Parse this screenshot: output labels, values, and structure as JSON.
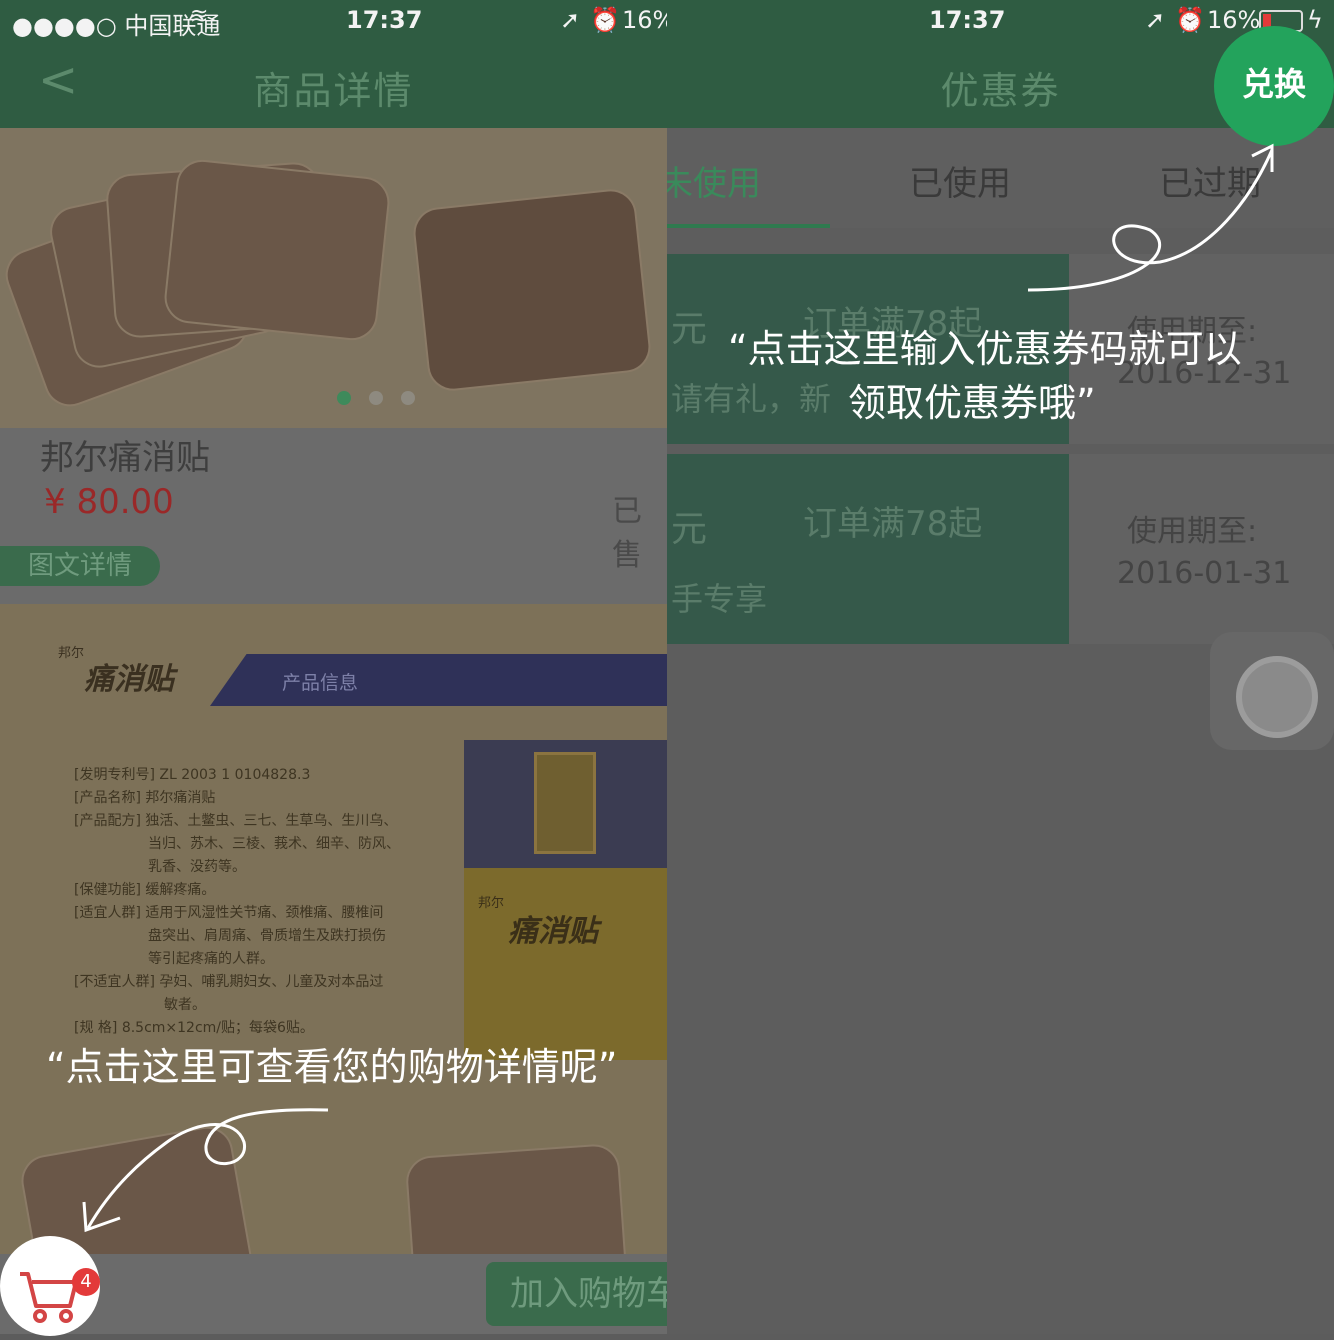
{
  "left": {
    "status": {
      "carrier": "●●●●○ 中国联通",
      "time": "17:37",
      "right": "16%"
    },
    "nav": {
      "back": "<",
      "title": "商品详情"
    },
    "product": {
      "name": "邦尔痛消贴",
      "price": "¥ 80.00",
      "sold": "已售"
    },
    "detail_tab": "图文详情",
    "detail_image": {
      "brand_small": "邦尔",
      "brand": "痛消贴",
      "section": "产品信息",
      "specs": [
        "[发明专利号] ZL 2003 1 0104828.3",
        "[产品名称] 邦尔痛消贴",
        "[产品配方] 独活、土鳖虫、三七、生草乌、生川乌、",
        "当归、苏木、三棱、莪术、细辛、防风、",
        "乳香、没药等。",
        "[保健功能] 缓解疼痛。",
        "[适宜人群] 适用于风湿性关节痛、颈椎痛、腰椎间",
        "盘突出、肩周痛、骨质增生及跌打损伤",
        "等引起疼痛的人群。",
        "[不适宜人群] 孕妇、哺乳期妇女、儿童及对本品过",
        "敏者。",
        "[规 格] 8.5cm×12cm/贴；每袋6贴。"
      ],
      "box_brand": "邦尔",
      "box_title": "痛消贴"
    },
    "add_cart": "加入购物车",
    "cart_badge": "4",
    "annotation": "“点击这里可查看您的购物详情呢”"
  },
  "right": {
    "status": {
      "time": "17:37",
      "right": "16%"
    },
    "nav": {
      "title": "优惠券",
      "exchange": "兑换"
    },
    "tabs": [
      "未使用",
      "已使用",
      "已过期"
    ],
    "coupons": [
      {
        "amount": "元",
        "condition": "订单满78起",
        "desc": "请有礼，新",
        "expiry_label": "使用期至:",
        "expiry": "2016-12-31"
      },
      {
        "amount": "元",
        "condition": "订单满78起",
        "desc": "手专享",
        "expiry_label": "使用期至:",
        "expiry": "2016-01-31"
      }
    ],
    "annotation_line1": "“点击这里输入优惠券码就可以",
    "annotation_line2": "领取优惠券哦”"
  },
  "colors": {
    "nav_bg": "#2f5c42",
    "accent": "#23a35c",
    "price": "#9a2828",
    "badge": "#e33a3a"
  }
}
